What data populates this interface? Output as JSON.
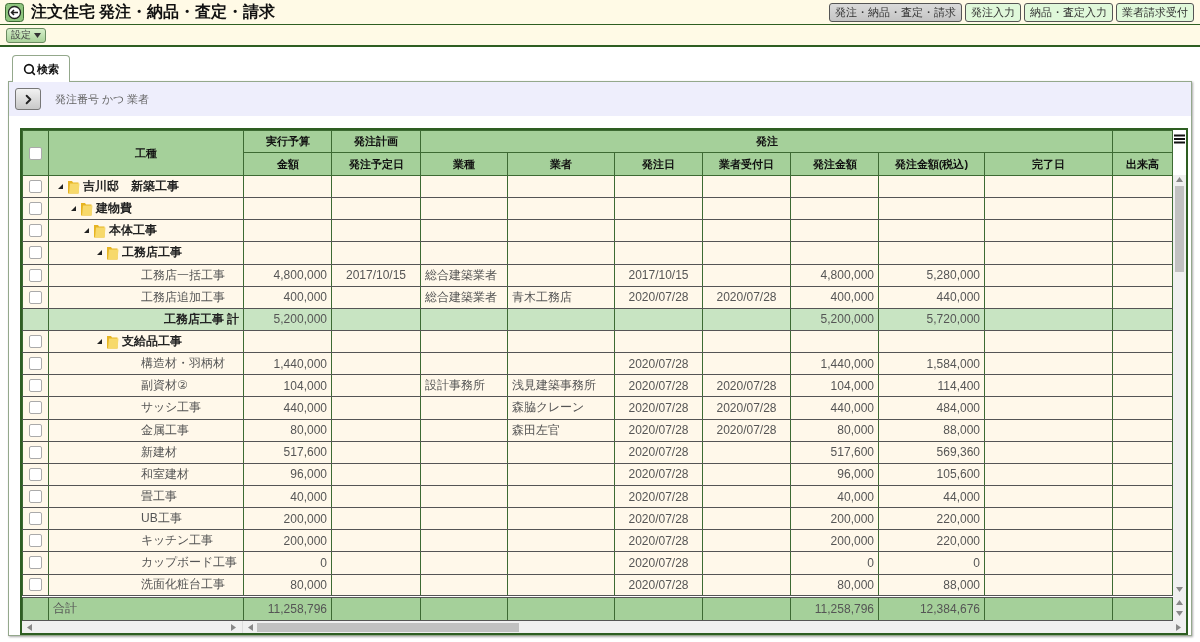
{
  "header": {
    "title": "注文住宅 発注・納品・査定・請求",
    "nav": [
      {
        "label": "発注・納品・査定・請求",
        "selected": true
      },
      {
        "label": "発注入力",
        "selected": false
      },
      {
        "label": "納品・査定入力",
        "selected": false
      },
      {
        "label": "業者請求受付",
        "selected": false
      }
    ]
  },
  "toolbar": {
    "settings_label": "設定"
  },
  "tabs": [
    {
      "label": "検索",
      "selected": true
    }
  ],
  "filter": {
    "text": "発注番号 かつ 業者"
  },
  "table": {
    "select_all_checked": false,
    "tree_header": "工種",
    "column_groups": [
      {
        "label": "実行予算",
        "columns": [
          {
            "label": "金額",
            "kind": "money"
          }
        ]
      },
      {
        "label": "発注計画",
        "columns": [
          {
            "label": "発注予定日",
            "kind": "date"
          }
        ]
      },
      {
        "label": "発注",
        "columns": [
          {
            "label": "業種",
            "kind": "text"
          },
          {
            "label": "業者",
            "kind": "text"
          },
          {
            "label": "発注日",
            "kind": "date"
          },
          {
            "label": "業者受付日",
            "kind": "date"
          },
          {
            "label": "発注金額",
            "kind": "money"
          },
          {
            "label": "発注金額(税込)",
            "kind": "money"
          },
          {
            "label": "完了日"
          }
        ]
      },
      {
        "columns": [
          {
            "label": "出来高"
          }
        ]
      }
    ],
    "rows": [
      {
        "kind": "group",
        "label": "吉川邸　新築工事",
        "checked": false,
        "expanded": true,
        "children": [
          {
            "kind": "group",
            "label": "建物費",
            "checked": false,
            "expanded": true,
            "children": [
              {
                "kind": "group",
                "label": "本体工事",
                "checked": false,
                "expanded": true,
                "children": [
                  {
                    "kind": "group",
                    "label": "工務店工事",
                    "checked": false,
                    "expanded": true,
                    "children": [
                      {
                        "kind": "item",
                        "label": "工務店一括工事",
                        "checked": false,
                        "cells": [
                          "4,800,000",
                          "2017/10/15",
                          "総合建築業者",
                          null,
                          "2017/10/15",
                          null,
                          "4,800,000",
                          "5,280,000",
                          null,
                          null
                        ]
                      },
                      {
                        "kind": "item",
                        "label": "工務店追加工事",
                        "checked": false,
                        "cells": [
                          "400,000",
                          null,
                          "総合建築業者",
                          "青木工務店",
                          "2020/07/28",
                          "2020/07/28",
                          "400,000",
                          "440,000",
                          null,
                          null
                        ]
                      },
                      {
                        "kind": "subtotal",
                        "label": "工務店工事 計",
                        "cells": [
                          "5,200,000",
                          null,
                          null,
                          null,
                          null,
                          null,
                          "5,200,000",
                          "5,720,000",
                          null,
                          null
                        ]
                      }
                    ]
                  },
                  {
                    "kind": "group",
                    "label": "支給品工事",
                    "checked": false,
                    "expanded": true,
                    "children": [
                      {
                        "kind": "item",
                        "label": "構造材・羽柄材",
                        "checked": false,
                        "cells": [
                          "1,440,000",
                          null,
                          null,
                          null,
                          "2020/07/28",
                          null,
                          "1,440,000",
                          "1,584,000",
                          null,
                          null
                        ]
                      },
                      {
                        "kind": "item",
                        "label": "副資材②",
                        "checked": false,
                        "cells": [
                          "104,000",
                          null,
                          "設計事務所",
                          "浅見建築事務所",
                          "2020/07/28",
                          "2020/07/28",
                          "104,000",
                          "114,400",
                          null,
                          null
                        ]
                      },
                      {
                        "kind": "item",
                        "label": "サッシ工事",
                        "checked": false,
                        "cells": [
                          "440,000",
                          null,
                          null,
                          "森脇クレーン",
                          "2020/07/28",
                          "2020/07/28",
                          "440,000",
                          "484,000",
                          null,
                          null
                        ]
                      },
                      {
                        "kind": "item",
                        "label": "金属工事",
                        "checked": false,
                        "cells": [
                          "80,000",
                          null,
                          null,
                          "森田左官",
                          "2020/07/28",
                          "2020/07/28",
                          "80,000",
                          "88,000",
                          null,
                          null
                        ]
                      },
                      {
                        "kind": "item",
                        "label": "新建材",
                        "checked": false,
                        "cells": [
                          "517,600",
                          null,
                          null,
                          null,
                          "2020/07/28",
                          null,
                          "517,600",
                          "569,360",
                          null,
                          null
                        ]
                      },
                      {
                        "kind": "item",
                        "label": "和室建材",
                        "checked": false,
                        "cells": [
                          "96,000",
                          null,
                          null,
                          null,
                          "2020/07/28",
                          null,
                          "96,000",
                          "105,600",
                          null,
                          null
                        ]
                      },
                      {
                        "kind": "item",
                        "label": "畳工事",
                        "checked": false,
                        "cells": [
                          "40,000",
                          null,
                          null,
                          null,
                          "2020/07/28",
                          null,
                          "40,000",
                          "44,000",
                          null,
                          null
                        ]
                      },
                      {
                        "kind": "item",
                        "label": "UB工事",
                        "checked": false,
                        "cells": [
                          "200,000",
                          null,
                          null,
                          null,
                          "2020/07/28",
                          null,
                          "200,000",
                          "220,000",
                          null,
                          null
                        ]
                      },
                      {
                        "kind": "item",
                        "label": "キッチン工事",
                        "checked": false,
                        "cells": [
                          "200,000",
                          null,
                          null,
                          null,
                          "2020/07/28",
                          null,
                          "200,000",
                          "220,000",
                          null,
                          null
                        ]
                      },
                      {
                        "kind": "item",
                        "label": "カップボード工事",
                        "checked": false,
                        "cells": [
                          "0",
                          null,
                          null,
                          null,
                          "2020/07/28",
                          null,
                          "0",
                          "0",
                          null,
                          null
                        ]
                      },
                      {
                        "kind": "item",
                        "label": "洗面化粧台工事",
                        "checked": false,
                        "cells": [
                          "80,000",
                          null,
                          null,
                          null,
                          "2020/07/28",
                          null,
                          "80,000",
                          "88,000",
                          null,
                          null
                        ]
                      }
                    ]
                  }
                ]
              }
            ]
          }
        ]
      }
    ],
    "total": {
      "label": "合計",
      "cells": [
        "11,258,796",
        null,
        null,
        null,
        null,
        null,
        "11,258,796",
        "12,384,676",
        null,
        null
      ]
    }
  }
}
